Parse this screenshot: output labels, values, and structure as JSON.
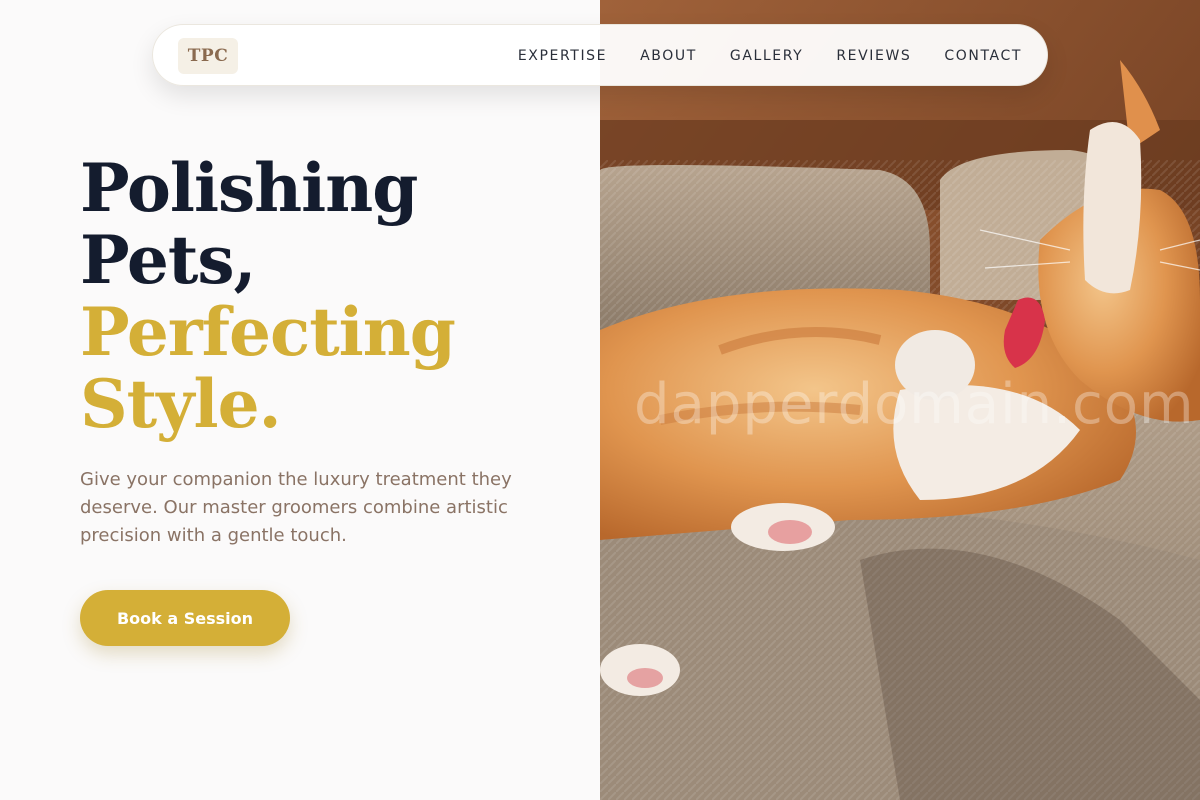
{
  "nav": {
    "logo": "TPC",
    "links": [
      "EXPERTISE",
      "ABOUT",
      "GALLERY",
      "REVIEWS",
      "CONTACT"
    ]
  },
  "hero": {
    "headline_line1": "Polishing",
    "headline_line2": "Pets,",
    "headline_line3": "Perfecting",
    "headline_line4": "Style.",
    "subtext": "Give your companion the luxury treatment they deserve. Our master groomers combine artistic precision with a gentle touch.",
    "cta_label": "Book a Session"
  },
  "image": {
    "watermark": "dapperdomain.com"
  },
  "colors": {
    "accent": "#d4af37",
    "headline_dark": "#141c2e",
    "body_text": "#8a7365"
  }
}
